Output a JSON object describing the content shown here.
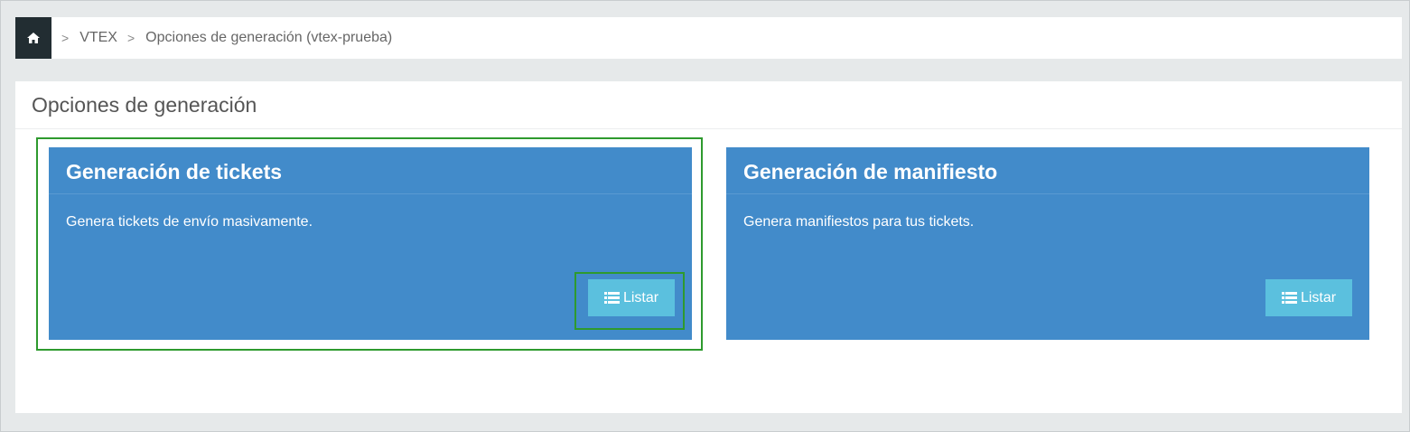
{
  "breadcrumb": {
    "home_icon": "home-icon",
    "items": [
      {
        "label": "VTEX"
      },
      {
        "label": "Opciones de generación (vtex-prueba)"
      }
    ],
    "separator": ">"
  },
  "panel": {
    "title": "Opciones de generación"
  },
  "cards": [
    {
      "title": "Generación de tickets",
      "description": "Genera tickets de envío masivamente.",
      "button_label": "Listar",
      "button_icon": "list-icon",
      "highlighted": true
    },
    {
      "title": "Generación de manifiesto",
      "description": "Genera manifiestos para tus tickets.",
      "button_label": "Listar",
      "button_icon": "list-icon",
      "highlighted": false
    }
  ],
  "colors": {
    "card_bg": "#428bca",
    "button_bg": "#5bc0de",
    "home_bg": "#222d32",
    "highlight": "#2e9a2e",
    "page_bg": "#e6e9ea"
  }
}
